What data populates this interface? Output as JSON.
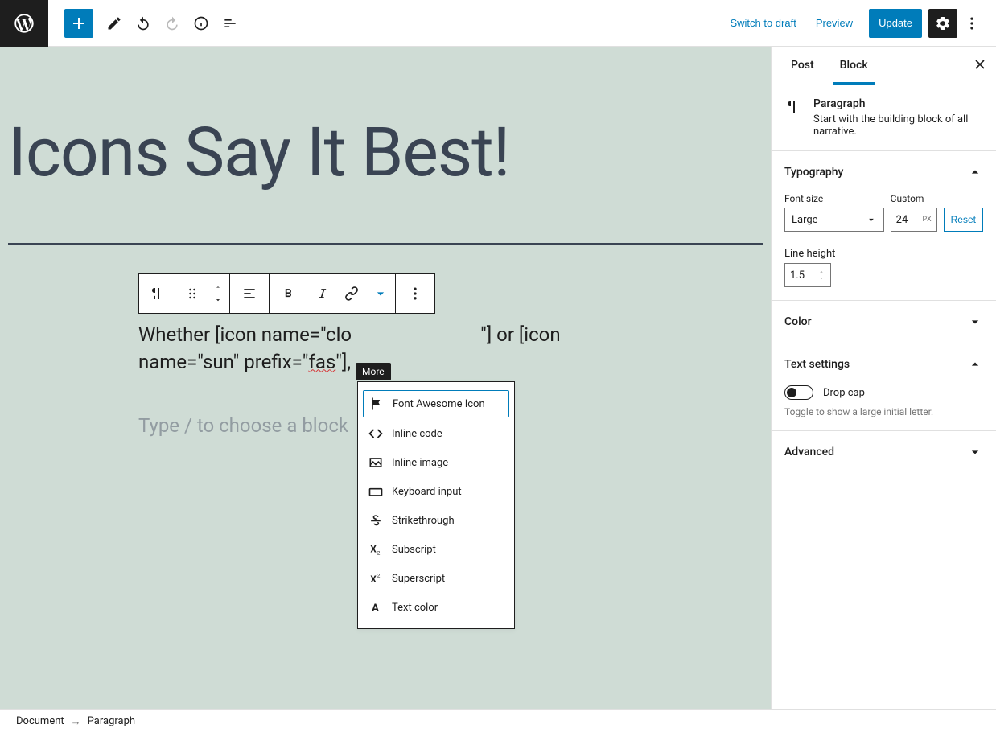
{
  "topbar": {
    "switch_draft": "Switch to draft",
    "preview": "Preview",
    "update": "Update"
  },
  "sidebar_tabs": {
    "post": "Post",
    "block": "Block"
  },
  "block_panel": {
    "title": "Paragraph",
    "desc": "Start with the building block of all narrative."
  },
  "typography": {
    "heading": "Typography",
    "font_size_label": "Font size",
    "font_size_value": "Large",
    "custom_label": "Custom",
    "custom_value": "24",
    "custom_unit": "PX",
    "reset": "Reset",
    "line_height_label": "Line height",
    "line_height_value": "1.5"
  },
  "color_panel": {
    "heading": "Color"
  },
  "text_settings": {
    "heading": "Text settings",
    "drop_cap": "Drop cap",
    "drop_cap_helper": "Toggle to show a large initial letter."
  },
  "advanced": {
    "heading": "Advanced"
  },
  "editor": {
    "title": "Icons Say It Best!",
    "para_part1": "Whether [icon name=\"clo",
    "para_part2": "\"] or [icon name=\"sun\" prefix=\"",
    "para_squiggle": "fas",
    "para_part3": "\"],",
    "placeholder": "Type / to choose a block"
  },
  "tooltip": "More",
  "dropdown": {
    "items": [
      "Font Awesome Icon",
      "Inline code",
      "Inline image",
      "Keyboard input",
      "Strikethrough",
      "Subscript",
      "Superscript",
      "Text color"
    ]
  },
  "breadcrumb": {
    "document": "Document",
    "paragraph": "Paragraph"
  }
}
